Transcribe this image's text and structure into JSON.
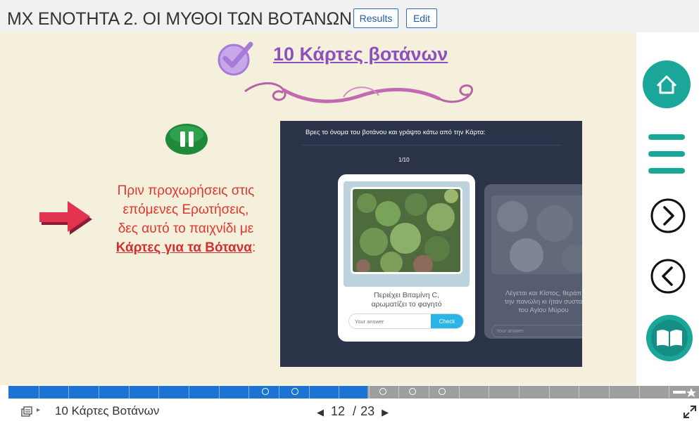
{
  "header": {
    "course_title": "MX ΕΝΟΤΗΤΑ 2. ΟΙ ΜΥΘΟΙ ΤΩΝ ΒΟΤΑΝΩΝ",
    "results_label": "Results",
    "edit_label": "Edit"
  },
  "slide": {
    "heading": "10 Κάρτες βοτάνων",
    "instruction_lines": [
      "Πριν προχωρήσεις στις",
      "επόμενες Ερωτήσεις,",
      "δες αυτό το παιχνίδι με"
    ],
    "link_text": "Κάρτες για τα Βότανα",
    "link_suffix": ":"
  },
  "game": {
    "instruction": "Βρες το όνομα του βοτάνου και γράψτο κάτω από την Κάρτα:",
    "progress": "1/10",
    "card1": {
      "text_line1": "Περιέχει Βιταμίνη C,",
      "text_line2": "αρωματίζει το φαγητό",
      "placeholder": "Your answer",
      "check_label": "Check"
    },
    "card2": {
      "text_line1": "Λέγεται και Κίστος, θεράπ",
      "text_line2": "την πανώλη κι ήταν συστα",
      "text_line3": "του Αγίου Μύρου",
      "placeholder": "Your answer"
    }
  },
  "nav": {
    "icons": [
      "home-icon",
      "menu-icon",
      "next-icon",
      "previous-icon",
      "book-icon"
    ]
  },
  "progress": {
    "fraction": 0.52
  },
  "footer": {
    "chapter_title": "10 Κάρτες Βοτάνων",
    "current_page": "12",
    "separator": "/",
    "total_pages": "23"
  },
  "colors": {
    "slide_bg": "#f5f0dc",
    "heading": "#8e4fbf",
    "instruction": "#e0362f",
    "teal": "#1aa79a",
    "game_bg": "#2a3348",
    "progress_fill": "#1b74d4",
    "check_button": "#29b6e6"
  }
}
